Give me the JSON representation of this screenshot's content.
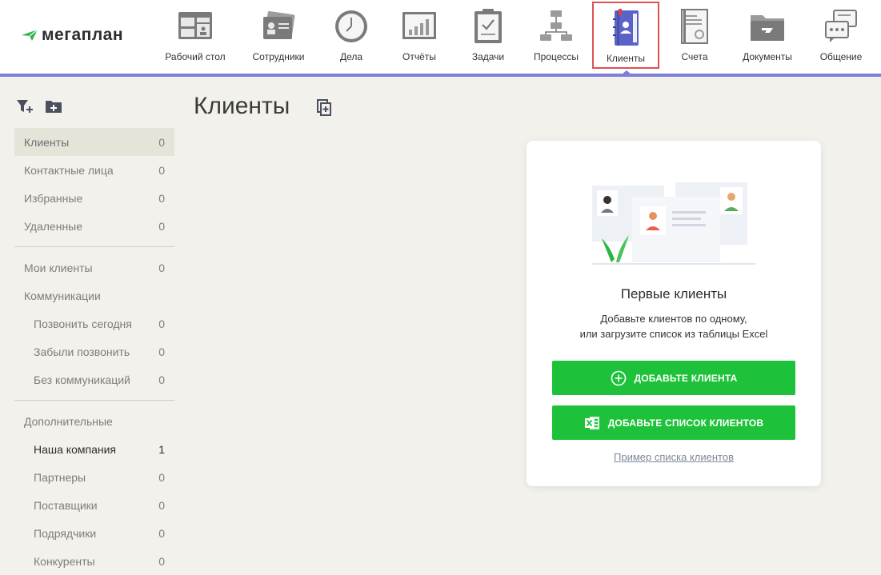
{
  "logo": {
    "text": "мегаплан"
  },
  "nav": [
    {
      "label": "Рабочий стол",
      "icon": "desktop-icon"
    },
    {
      "label": "Сотрудники",
      "icon": "employees-icon"
    },
    {
      "label": "Дела",
      "icon": "clock-icon"
    },
    {
      "label": "Отчёты",
      "icon": "reports-icon"
    },
    {
      "label": "Задачи",
      "icon": "tasks-icon"
    },
    {
      "label": "Процессы",
      "icon": "processes-icon"
    },
    {
      "label": "Клиенты",
      "icon": "clients-icon",
      "active": true
    },
    {
      "label": "Счета",
      "icon": "invoices-icon"
    },
    {
      "label": "Документы",
      "icon": "documents-icon"
    },
    {
      "label": "Общение",
      "icon": "chat-icon"
    }
  ],
  "sidebar": {
    "main": [
      {
        "label": "Клиенты",
        "count": "0"
      },
      {
        "label": "Контактные лица",
        "count": "0"
      },
      {
        "label": "Избранные",
        "count": "0"
      },
      {
        "label": "Удаленные",
        "count": "0"
      }
    ],
    "mine": {
      "label": "Мои клиенты",
      "count": "0"
    },
    "communications": {
      "label": "Коммуникации",
      "items": [
        {
          "label": "Позвонить сегодня",
          "count": "0"
        },
        {
          "label": "Забыли позвонить",
          "count": "0"
        },
        {
          "label": "Без коммуникаций",
          "count": "0"
        }
      ]
    },
    "extra": {
      "label": "Дополнительные",
      "items": [
        {
          "label": "Наша компания",
          "count": "1"
        },
        {
          "label": "Партнеры",
          "count": "0"
        },
        {
          "label": "Поставщики",
          "count": "0"
        },
        {
          "label": "Подрядчики",
          "count": "0"
        },
        {
          "label": "Конкуренты",
          "count": "0"
        }
      ]
    }
  },
  "main": {
    "title": "Клиенты"
  },
  "empty_card": {
    "title": "Первые клиенты",
    "desc_line1": "Добавьте клиентов по одному,",
    "desc_line2": "или загрузите список из таблицы Excel",
    "add_client": "ДОБАВЬТЕ КЛИЕНТА",
    "add_list": "ДОБАВЬТЕ СПИСОК КЛИЕНТОВ",
    "example_link": "Пример списка клиентов"
  },
  "colors": {
    "accent": "#7b7fd9",
    "green": "#1ec23a",
    "active_outline": "#e05050",
    "background": "#f2f1ec"
  }
}
